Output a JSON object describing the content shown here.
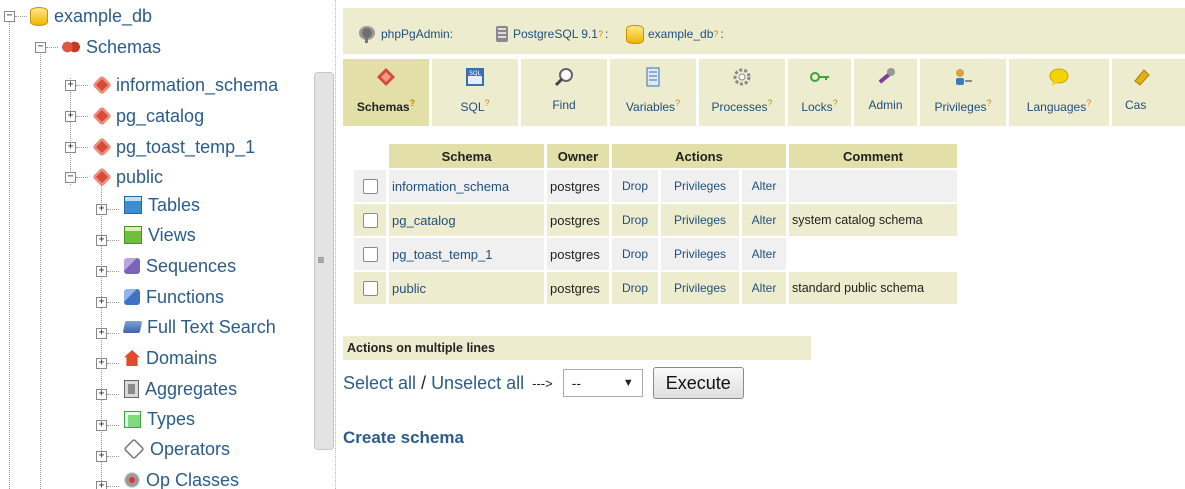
{
  "tree": {
    "nodes": [
      {
        "label": "example_db",
        "icon": "database-icon",
        "toggle": "−"
      },
      {
        "label": "Schemas",
        "icon": "schemas-icon",
        "toggle": "−"
      },
      {
        "label": "information_schema",
        "icon": "schema-icon",
        "toggle": "+"
      },
      {
        "label": "pg_catalog",
        "icon": "schema-icon",
        "toggle": "+"
      },
      {
        "label": "pg_toast_temp_1",
        "icon": "schema-icon",
        "toggle": "+"
      },
      {
        "label": "public",
        "icon": "schema-icon",
        "toggle": "−"
      },
      {
        "label": "Tables",
        "icon": "tables-icon",
        "toggle": "+"
      },
      {
        "label": "Views",
        "icon": "views-icon",
        "toggle": "+"
      },
      {
        "label": "Sequences",
        "icon": "sequences-icon",
        "toggle": "+"
      },
      {
        "label": "Functions",
        "icon": "functions-icon",
        "toggle": "+"
      },
      {
        "label": "Full Text Search",
        "icon": "full-text-search-icon",
        "toggle": "+"
      },
      {
        "label": "Domains",
        "icon": "domains-icon",
        "toggle": "+"
      },
      {
        "label": "Aggregates",
        "icon": "aggregates-icon",
        "toggle": "+"
      },
      {
        "label": "Types",
        "icon": "types-icon",
        "toggle": "+"
      },
      {
        "label": "Operators",
        "icon": "operators-icon",
        "toggle": "+"
      },
      {
        "label": "Op Classes",
        "icon": "op-classes-icon",
        "toggle": "+"
      }
    ],
    "splitter_grip": "≡"
  },
  "breadcrumb": {
    "app": "phpPgAdmin:",
    "server": "PostgreSQL 9.1",
    "server_help": "?",
    "server_sep": ":",
    "database": "example_db",
    "database_help": "?",
    "database_sep": ":"
  },
  "tabs": [
    {
      "label": "Schemas",
      "help": "?",
      "icon": "schemas-icon"
    },
    {
      "label": "SQL",
      "help": "?",
      "icon": "sql-icon"
    },
    {
      "label": "Find",
      "help": "",
      "icon": "find-icon"
    },
    {
      "label": "Variables",
      "help": "?",
      "icon": "variables-icon"
    },
    {
      "label": "Processes",
      "help": "?",
      "icon": "processes-icon"
    },
    {
      "label": "Locks",
      "help": "?",
      "icon": "locks-icon"
    },
    {
      "label": "Admin",
      "help": "",
      "icon": "admin-icon"
    },
    {
      "label": "Privileges",
      "help": "?",
      "icon": "privileges-icon"
    },
    {
      "label": "Languages",
      "help": "?",
      "icon": "languages-icon"
    },
    {
      "label": "Cas",
      "help": "",
      "icon": "casts-icon"
    }
  ],
  "table": {
    "headers": {
      "schema": "Schema",
      "owner": "Owner",
      "actions": "Actions",
      "comment": "Comment"
    },
    "rows": [
      {
        "schema": "information_schema",
        "owner": "postgres",
        "drop": "Drop",
        "privileges": "Privileges",
        "alter": "Alter",
        "comment": ""
      },
      {
        "schema": "pg_catalog",
        "owner": "postgres",
        "drop": "Drop",
        "privileges": "Privileges",
        "alter": "Alter",
        "comment": "system catalog schema"
      },
      {
        "schema": "pg_toast_temp_1",
        "owner": "postgres",
        "drop": "Drop",
        "privileges": "Privileges",
        "alter": "Alter",
        "comment": ""
      },
      {
        "schema": "public",
        "owner": "postgres",
        "drop": "Drop",
        "privileges": "Privileges",
        "alter": "Alter",
        "comment": "standard public schema"
      }
    ]
  },
  "multi": {
    "heading": "Actions on multiple lines",
    "select_all": "Select all",
    "separator": " / ",
    "unselect_all": "Unselect all",
    "arrow": "--->",
    "select_value": "--",
    "execute": "Execute"
  },
  "create_schema": "Create schema",
  "colors": {
    "accent_bg": "#eeeccf",
    "active_tab": "#e2dfa9",
    "link": "#2b5c8a"
  }
}
